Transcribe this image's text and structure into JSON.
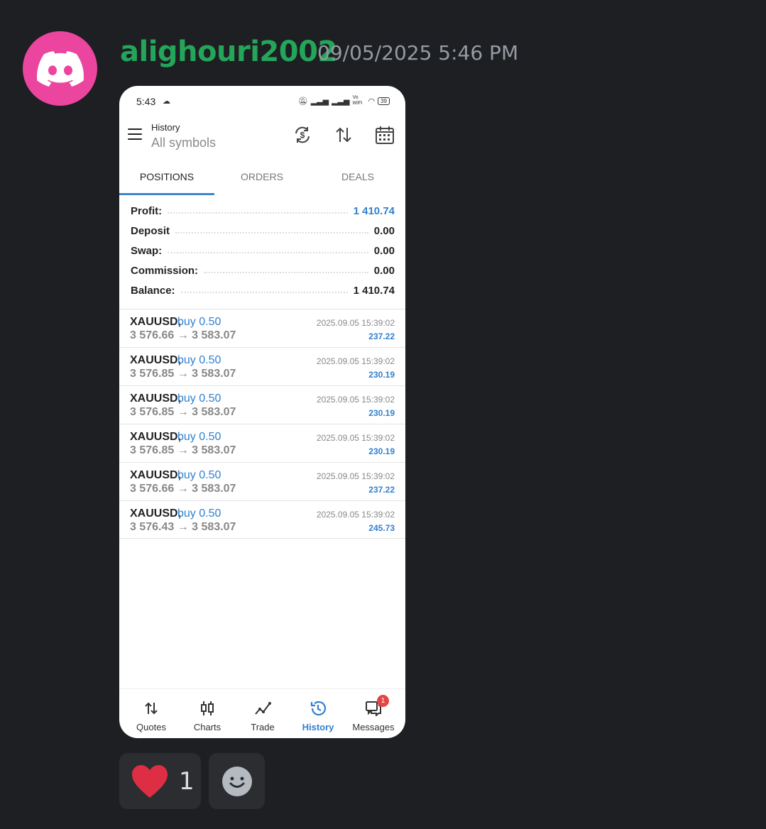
{
  "message": {
    "username": "alighouri2002",
    "timestamp": "09/05/2025 5:46 PM",
    "avatar_icon": "discord-logo-icon",
    "colors": {
      "username": "#23a55a",
      "avatar_bg": "#eb459f",
      "background": "#1e1f22"
    }
  },
  "phone": {
    "status": {
      "time": "5:43",
      "battery": "39",
      "volte": "Vo WiFi"
    },
    "appbar": {
      "title": "History",
      "subtitle": "All symbols"
    },
    "tabs": [
      {
        "label": "POSITIONS",
        "active": true
      },
      {
        "label": "ORDERS",
        "active": false
      },
      {
        "label": "DEALS",
        "active": false
      }
    ],
    "summary": [
      {
        "label": "Profit:",
        "value": "1 410.74"
      },
      {
        "label": "Deposit",
        "value": "0.00"
      },
      {
        "label": "Swap:",
        "value": "0.00"
      },
      {
        "label": "Commission:",
        "value": "0.00"
      },
      {
        "label": "Balance:",
        "value": "1 410.74"
      }
    ],
    "positions": [
      {
        "symbol": "XAUUSD,",
        "type": "buy 0.50",
        "prices": "3 576.66 → 3 583.07",
        "time": "2025.09.05 15:39:02",
        "profit": "237.22"
      },
      {
        "symbol": "XAUUSD,",
        "type": "buy 0.50",
        "prices": "3 576.85 → 3 583.07",
        "time": "2025.09.05 15:39:02",
        "profit": "230.19"
      },
      {
        "symbol": "XAUUSD,",
        "type": "buy 0.50",
        "prices": "3 576.85 → 3 583.07",
        "time": "2025.09.05 15:39:02",
        "profit": "230.19"
      },
      {
        "symbol": "XAUUSD,",
        "type": "buy 0.50",
        "prices": "3 576.85 → 3 583.07",
        "time": "2025.09.05 15:39:02",
        "profit": "230.19"
      },
      {
        "symbol": "XAUUSD,",
        "type": "buy 0.50",
        "prices": "3 576.66 → 3 583.07",
        "time": "2025.09.05 15:39:02",
        "profit": "237.22"
      },
      {
        "symbol": "XAUUSD,",
        "type": "buy 0.50",
        "prices": "3 576.43 → 3 583.07",
        "time": "2025.09.05 15:39:02",
        "profit": "245.73"
      }
    ],
    "bottom_nav": [
      {
        "label": "Quotes",
        "icon": "quotes-arrows-icon",
        "active": false
      },
      {
        "label": "Charts",
        "icon": "candlestick-icon",
        "active": false
      },
      {
        "label": "Trade",
        "icon": "trend-line-icon",
        "active": false
      },
      {
        "label": "History",
        "icon": "history-clock-icon",
        "active": true
      },
      {
        "label": "Messages",
        "icon": "chat-bubbles-icon",
        "active": false,
        "badge": "1"
      }
    ],
    "colors": {
      "accent": "#3080cf"
    }
  },
  "reactions": [
    {
      "emoji_icon": "red-heart-icon",
      "count": "1"
    },
    {
      "emoji_icon": "add-reaction-smiley-icon"
    }
  ]
}
